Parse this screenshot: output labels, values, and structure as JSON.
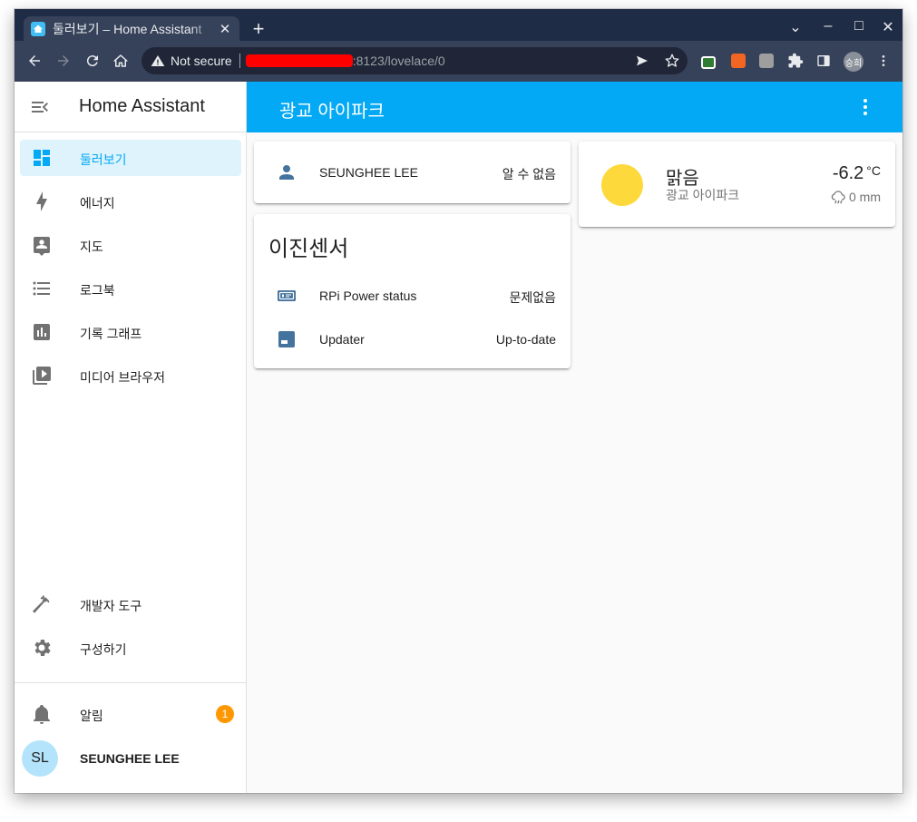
{
  "browser": {
    "tab_title": "둘러보기 – Home Assistant",
    "new_tab_symbol": "+",
    "close_symbol": "✕",
    "security_label": "Not secure",
    "url_visible": ":8123/lovelace/0",
    "profile_initials": "승희",
    "window_controls": {
      "menu": "⌄",
      "minimize": "–",
      "maximize": "□",
      "close": "✕"
    }
  },
  "sidebar": {
    "title": "Home Assistant",
    "items": [
      {
        "label": "둘러보기",
        "icon": "view-dashboard-icon"
      },
      {
        "label": "에너지",
        "icon": "lightning-bolt-icon"
      },
      {
        "label": "지도",
        "icon": "map-account-icon"
      },
      {
        "label": "로그북",
        "icon": "format-list-bulleted-icon"
      },
      {
        "label": "기록 그래프",
        "icon": "chart-box-icon"
      },
      {
        "label": "미디어 브라우저",
        "icon": "play-box-multiple-icon"
      }
    ],
    "bottom_items": [
      {
        "label": "개발자 도구",
        "icon": "hammer-icon"
      },
      {
        "label": "구성하기",
        "icon": "cog-icon"
      }
    ],
    "notifications": {
      "label": "알림",
      "count": "1"
    },
    "user": {
      "initials": "SL",
      "name": "SEUNGHEE LEE"
    }
  },
  "header": {
    "title": "광교 아이파크"
  },
  "cards": {
    "person": {
      "name": "SEUNGHEE LEE",
      "state": "알 수 없음"
    },
    "entities": {
      "title": "이진센서",
      "rows": [
        {
          "name": "RPi Power status",
          "state": "문제없음",
          "icon": "raspberry-pi-icon"
        },
        {
          "name": "Updater",
          "state": "Up-to-date",
          "icon": "package-icon"
        }
      ]
    },
    "weather": {
      "condition": "맑음",
      "location": "광교 아이파크",
      "temperature": "-6.2",
      "unit": "°C",
      "precipitation": "0 mm"
    }
  },
  "colors": {
    "primary": "#03a9f4",
    "sidebar_active_bg": "#dff3fd",
    "badge": "#ff9800",
    "sun": "#fdd93c",
    "entity_icon": "#44739e",
    "browser_frame": "#1f2c45"
  }
}
